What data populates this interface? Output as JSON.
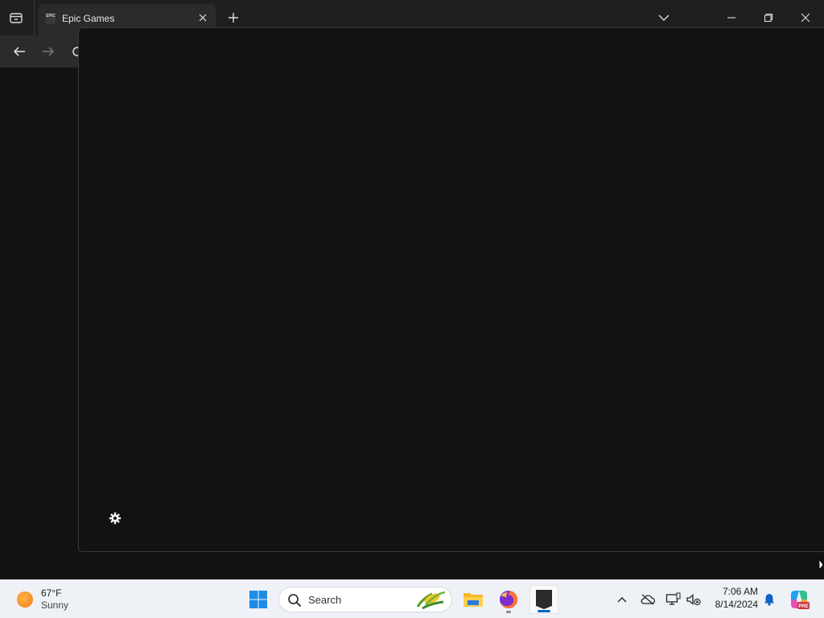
{
  "browser": {
    "tab": {
      "title": "Epic Games",
      "favicon_text": "EPIC",
      "favicon_icon": "epic-games-icon"
    },
    "icons": {
      "tab_actions": "tab-actions-icon",
      "tab_close": "close-icon",
      "new_tab": "plus-icon",
      "tab_list": "chevron-down-icon",
      "minimize": "minimize-icon",
      "maximize": "restore-icon",
      "close": "close-icon",
      "back": "arrow-left-icon",
      "forward": "arrow-right-icon",
      "refresh": "refresh-icon"
    }
  },
  "launcher": {
    "settings_icon": "gear-icon"
  },
  "taskbar": {
    "weather": {
      "temperature": "67°F",
      "condition": "Sunny",
      "icon": "sun-icon"
    },
    "search": {
      "label": "Search"
    },
    "apps": [
      {
        "name": "File Explorer",
        "icon": "folder-icon"
      },
      {
        "name": "Firefox",
        "icon": "firefox-icon"
      },
      {
        "name": "Epic Games Launcher",
        "icon": "epic-games-icon",
        "text": "EPIC"
      }
    ],
    "tray": {
      "icons": [
        "chevron-up-icon",
        "onedrive-icon",
        "network-icon",
        "volume-icon",
        "bell-icon",
        "copilot-icon"
      ],
      "time": "7:06 AM",
      "date": "8/14/2024"
    }
  },
  "colors": {
    "background": "#121212",
    "titlebar": "#1f1f1f",
    "navbar": "#2b2b2b",
    "taskbar": "#eef1f6",
    "accent": "#0a62c7"
  }
}
